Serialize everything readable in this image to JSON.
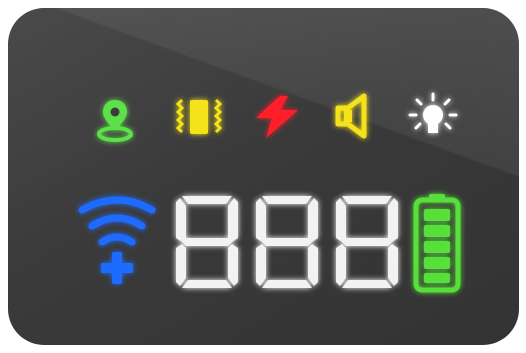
{
  "status_icons": [
    {
      "name": "location-pin-icon",
      "color": "#5ee04a"
    },
    {
      "name": "vibration-icon",
      "color": "#f4e21a"
    },
    {
      "name": "lightning-bolt-icon",
      "color": "#ff1e2a"
    },
    {
      "name": "speaker-icon",
      "color": "#f4e21a"
    },
    {
      "name": "light-bulb-icon",
      "color": "#ffffff"
    }
  ],
  "wifi": {
    "name": "wifi-plus-icon",
    "color": "#1e6cff"
  },
  "display": {
    "value": "888",
    "color": "#f2f2f2"
  },
  "battery": {
    "name": "battery-icon",
    "color": "#58e03a",
    "level": 1.0,
    "bars": 5
  }
}
